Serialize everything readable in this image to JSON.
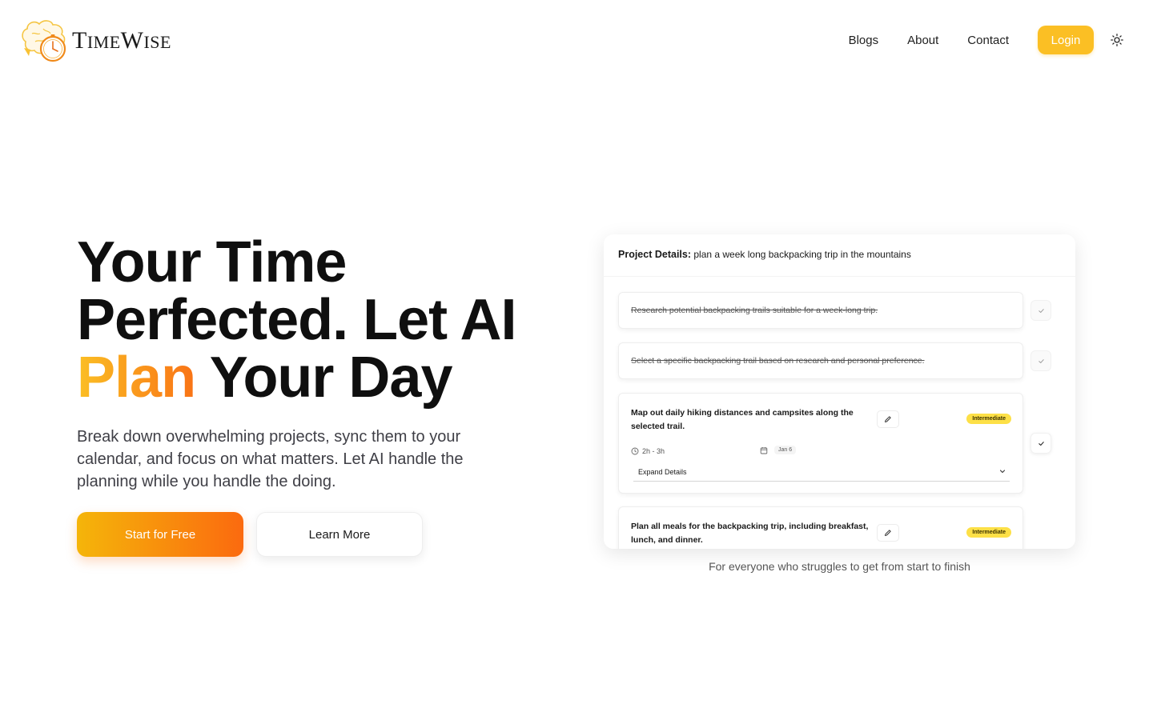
{
  "brand": {
    "name_parts": [
      "T",
      "IME",
      "W",
      "ISE"
    ],
    "logo_icon": "brain-clock-icon",
    "colors": {
      "accent": "#fbbf24",
      "accent_end": "#f97316"
    }
  },
  "nav": {
    "links": [
      "Blogs",
      "About",
      "Contact"
    ],
    "login_label": "Login",
    "theme_icon": "sun-icon"
  },
  "hero": {
    "title_line1": "Your Time",
    "title_line2": "Perfected. Let AI",
    "title_accent": "Plan",
    "title_line3_rest": " Your Day",
    "description": "Break down overwhelming projects, sync them to your calendar, and focus on what matters. Let AI handle the planning while you handle the doing.",
    "primary_cta": "Start for Free",
    "secondary_cta": "Learn More"
  },
  "demo": {
    "project_label": "Project Details:",
    "project_name": "plan a week long backpacking trip in the mountains",
    "tasks": [
      {
        "text": "Research potential backpacking trails suitable for a week-long trip.",
        "completed": true
      },
      {
        "text": "Select a specific backpacking trail based on research and personal preference.",
        "completed": true
      },
      {
        "text": "Map out daily hiking distances and campsites along the selected trail.",
        "completed": false,
        "level": "Intermediate",
        "duration": "2h - 3h",
        "date": "Jan 6",
        "expand_label": "Expand Details"
      },
      {
        "text": "Plan all meals for the backpacking trip, including breakfast, lunch, and dinner.",
        "completed": false,
        "level": "Intermediate"
      }
    ],
    "tagline": "For everyone who struggles to get from start to finish"
  }
}
